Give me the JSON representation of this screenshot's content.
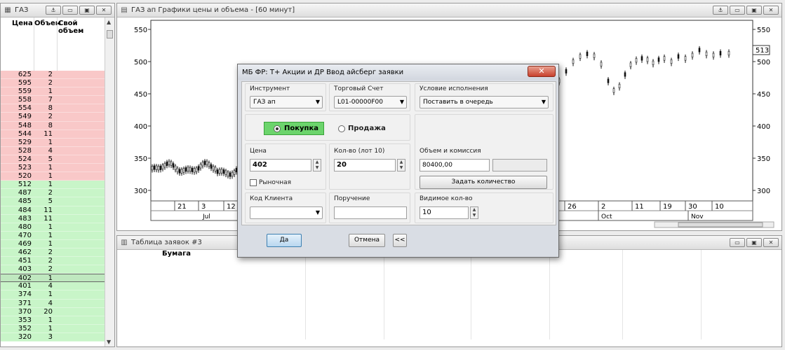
{
  "book": {
    "title": "ГАЗ",
    "headers": [
      "Цена",
      "Объем",
      "Свой объем"
    ],
    "sell_rows": [
      [
        "625",
        "2"
      ],
      [
        "595",
        "2"
      ],
      [
        "559",
        "1"
      ],
      [
        "558",
        "7"
      ],
      [
        "554",
        "8"
      ],
      [
        "549",
        "2"
      ],
      [
        "548",
        "8"
      ],
      [
        "544",
        "11"
      ],
      [
        "529",
        "1"
      ],
      [
        "528",
        "4"
      ],
      [
        "524",
        "5"
      ],
      [
        "523",
        "1"
      ],
      [
        "520",
        "1"
      ]
    ],
    "buy_rows": [
      [
        "512",
        "1"
      ],
      [
        "487",
        "2"
      ],
      [
        "485",
        "5"
      ],
      [
        "484",
        "11"
      ],
      [
        "483",
        "11"
      ],
      [
        "480",
        "1"
      ],
      [
        "470",
        "1"
      ],
      [
        "469",
        "1"
      ],
      [
        "462",
        "2"
      ],
      [
        "451",
        "2"
      ],
      [
        "403",
        "2"
      ],
      [
        "402",
        "1"
      ],
      [
        "401",
        "4"
      ],
      [
        "374",
        "1"
      ],
      [
        "371",
        "4"
      ],
      [
        "370",
        "20"
      ],
      [
        "353",
        "1"
      ],
      [
        "352",
        "1"
      ],
      [
        "320",
        "3"
      ]
    ],
    "current_price": "402"
  },
  "chart": {
    "title": "ГАЗ ап Графики цены и объема - [60 минут]",
    "y_ticks": [
      "550",
      "500",
      "450",
      "400",
      "350",
      "300"
    ],
    "last_price": "513",
    "x_left_labels": [
      "21",
      "3",
      "12"
    ],
    "x_left_month": "Jul",
    "x_right_labels": [
      "26",
      "2",
      "11",
      "19",
      "30",
      "10"
    ],
    "x_right_months": [
      "Oct",
      "Nov"
    ]
  },
  "orders": {
    "title": "Таблица заявок #3",
    "column_header": "Бумага"
  },
  "dialog": {
    "title": "МБ ФР: Т+ Акции и ДР Ввод айсберг заявки",
    "close": "✕",
    "instrument_label": "Инструмент",
    "instrument_value": "ГАЗ ап",
    "account_label": "Торговый Счет",
    "account_value": "L01-00000F00",
    "condition_label": "Условие исполнения",
    "condition_value": "Поставить в очередь",
    "buy_label": "Покупка",
    "sell_label": "Продажа",
    "price_label": "Цена",
    "price_value": "402",
    "qty_label": "Кол-во (лот 10)",
    "qty_value": "20",
    "volume_label": "Объем и комиссия",
    "volume_value": "80400,00",
    "commission_value": "",
    "set_qty_button": "Задать количество",
    "market_label": "Рыночная",
    "client_code_label": "Код Клиента",
    "client_code_value": "",
    "assignment_label": "Поручение",
    "assignment_value": "",
    "visible_qty_label": "Видимое кол-во",
    "visible_qty_value": "10",
    "ok_button": "Да",
    "cancel_button": "Отмена",
    "collapse_button": "<<"
  }
}
